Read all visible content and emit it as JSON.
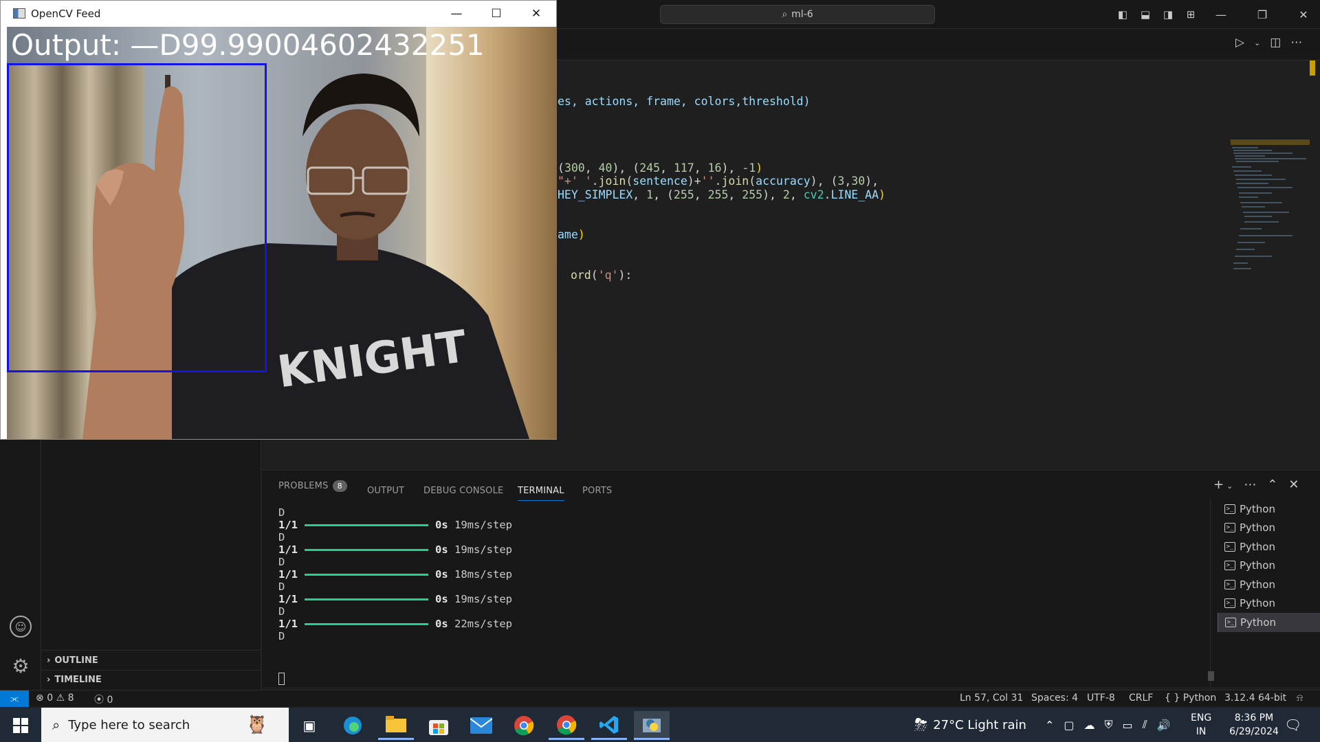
{
  "vscode": {
    "search_text": "ml-6",
    "code_lines": [
      {
        "parts": [
          {
            "t": "es, actions, frame, colors,threshold)",
            "c": "kw-b"
          }
        ]
      },
      {
        "parts": [
          {
            "t": "(",
            "c": ""
          },
          {
            "t": "300",
            "c": "kw-n"
          },
          {
            "t": ", ",
            "c": ""
          },
          {
            "t": "40",
            "c": "kw-n"
          },
          {
            "t": "), (",
            "c": ""
          },
          {
            "t": "245",
            "c": "kw-n"
          },
          {
            "t": ", ",
            "c": ""
          },
          {
            "t": "117",
            "c": "kw-n"
          },
          {
            "t": ", ",
            "c": ""
          },
          {
            "t": "16",
            "c": "kw-n"
          },
          {
            "t": "), ",
            "c": ""
          },
          {
            "t": "-1",
            "c": "kw-n"
          },
          {
            "t": ")",
            "c": "kw-p"
          }
        ]
      },
      {
        "parts": [
          {
            "t": "\"+' '",
            "c": "kw-s"
          },
          {
            "t": ".",
            "c": ""
          },
          {
            "t": "join",
            "c": "kw-y"
          },
          {
            "t": "(",
            "c": ""
          },
          {
            "t": "sentence",
            "c": "kw-b"
          },
          {
            "t": ")+",
            "c": ""
          },
          {
            "t": "''",
            "c": "kw-s"
          },
          {
            "t": ".",
            "c": ""
          },
          {
            "t": "join",
            "c": "kw-y"
          },
          {
            "t": "(",
            "c": ""
          },
          {
            "t": "accuracy",
            "c": "kw-b"
          },
          {
            "t": "), (",
            "c": ""
          },
          {
            "t": "3",
            "c": "kw-n"
          },
          {
            "t": ",",
            "c": ""
          },
          {
            "t": "30",
            "c": "kw-n"
          },
          {
            "t": "),",
            "c": ""
          }
        ]
      },
      {
        "parts": [
          {
            "t": "HEY_SIMPLEX",
            "c": "kw-b"
          },
          {
            "t": ", ",
            "c": ""
          },
          {
            "t": "1",
            "c": "kw-n"
          },
          {
            "t": ", (",
            "c": ""
          },
          {
            "t": "255",
            "c": "kw-n"
          },
          {
            "t": ", ",
            "c": ""
          },
          {
            "t": "255",
            "c": "kw-n"
          },
          {
            "t": ", ",
            "c": ""
          },
          {
            "t": "255",
            "c": "kw-n"
          },
          {
            "t": "), ",
            "c": ""
          },
          {
            "t": "2",
            "c": "kw-n"
          },
          {
            "t": ", ",
            "c": ""
          },
          {
            "t": "cv2",
            "c": "kw-g"
          },
          {
            "t": ".",
            "c": ""
          },
          {
            "t": "LINE_AA",
            "c": "kw-b"
          },
          {
            "t": ")",
            "c": "kw-p"
          }
        ]
      },
      {
        "parts": [
          {
            "t": "ame",
            "c": "kw-b"
          },
          {
            "t": ")",
            "c": "kw-p"
          }
        ]
      },
      {
        "parts": [
          {
            "t": " ",
            "c": ""
          },
          {
            "t": "ord",
            "c": "kw-y"
          },
          {
            "t": "(",
            "c": ""
          },
          {
            "t": "'q'",
            "c": "kw-s"
          },
          {
            "t": "):",
            "c": ""
          }
        ]
      }
    ],
    "sidebar": {
      "outline": "OUTLINE",
      "timeline": "TIMELINE"
    },
    "panel": {
      "tabs": {
        "problems": "PROBLEMS",
        "problems_count": "8",
        "output": "OUTPUT",
        "debug": "DEBUG CONSOLE",
        "terminal": "TERMINAL",
        "ports": "PORTS"
      },
      "terminal_lines": [
        {
          "type": "text",
          "text": "D"
        },
        {
          "type": "step",
          "count": "1/1",
          "time": "0s",
          "rate": "19ms/step"
        },
        {
          "type": "text",
          "text": "D"
        },
        {
          "type": "step",
          "count": "1/1",
          "time": "0s",
          "rate": "19ms/step"
        },
        {
          "type": "text",
          "text": "D"
        },
        {
          "type": "step",
          "count": "1/1",
          "time": "0s",
          "rate": "18ms/step"
        },
        {
          "type": "text",
          "text": "D"
        },
        {
          "type": "step",
          "count": "1/1",
          "time": "0s",
          "rate": "19ms/step"
        },
        {
          "type": "text",
          "text": "D"
        },
        {
          "type": "step",
          "count": "1/1",
          "time": "0s",
          "rate": "22ms/step"
        },
        {
          "type": "text",
          "text": "D"
        }
      ],
      "terminals": [
        "Python",
        "Python",
        "Python",
        "Python",
        "Python",
        "Python",
        "Python"
      ]
    },
    "status": {
      "errors": "0",
      "warnings": "8",
      "ports": "0",
      "position": "Ln 57, Col 31",
      "spaces": "Spaces: 4",
      "encoding": "UTF-8",
      "eol": "CRLF",
      "language": "Python",
      "interpreter": "3.12.4 64-bit"
    }
  },
  "opencv": {
    "window_title": "OpenCV Feed",
    "output_text": "Output:  —D99.99004602432251"
  },
  "taskbar": {
    "search_placeholder": "Type here to search",
    "weather": "27°C  Light rain",
    "lang_top": "ENG",
    "lang_bottom": "IN",
    "time": "8:36 PM",
    "date": "6/29/2024"
  }
}
